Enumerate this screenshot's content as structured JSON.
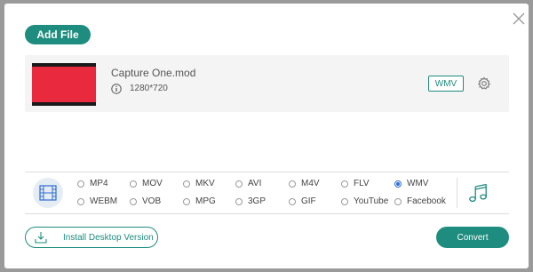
{
  "toolbar": {
    "add_file_label": "Add File"
  },
  "file": {
    "name": "Capture One.mod",
    "resolution": "1280*720",
    "output_format": "WMV",
    "thumbnail_color": "#e8293e"
  },
  "formats": {
    "row1": [
      "MP4",
      "MOV",
      "MKV",
      "AVI",
      "M4V",
      "FLV",
      "WMV"
    ],
    "row2": [
      "WEBM",
      "VOB",
      "MPG",
      "3GP",
      "GIF",
      "YouTube",
      "Facebook"
    ],
    "selected": "WMV"
  },
  "footer": {
    "install_label": "Install Desktop Version",
    "convert_label": "Convert"
  },
  "icons": {
    "close": "close-icon",
    "info": "info-icon",
    "settings": "gear-icon",
    "video": "film-icon",
    "audio": "music-note-icon",
    "download": "download-icon"
  },
  "colors": {
    "accent": "#1e8c7e",
    "radio_selected": "#2d6ecf"
  }
}
